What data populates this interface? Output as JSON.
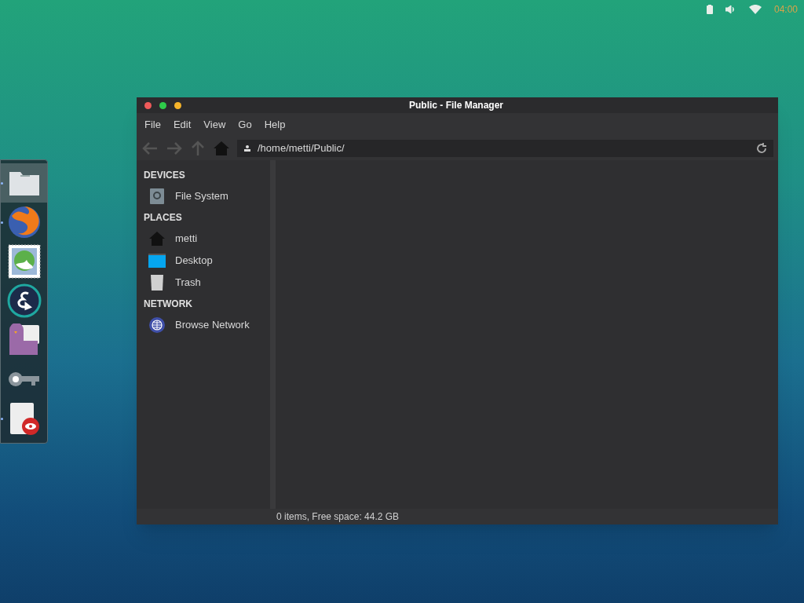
{
  "top_panel": {
    "clock": "04:00"
  },
  "dock": {
    "items": [
      {
        "kind": "folder",
        "running": true,
        "selected": true
      },
      {
        "kind": "browser",
        "running": true,
        "selected": false
      },
      {
        "kind": "mail",
        "running": false,
        "selected": false
      },
      {
        "kind": "editor",
        "running": false,
        "selected": false
      },
      {
        "kind": "chat",
        "running": false,
        "selected": false
      },
      {
        "kind": "key",
        "running": false,
        "selected": false
      },
      {
        "kind": "viewer",
        "running": true,
        "selected": false
      }
    ]
  },
  "window": {
    "title": "Public - File Manager",
    "menu": [
      "File",
      "Edit",
      "View",
      "Go",
      "Help"
    ],
    "toolbar": {
      "path": "/home/metti/Public/"
    },
    "sidebar": {
      "sections": [
        {
          "heading": "DEVICES",
          "items": [
            {
              "kind": "drive",
              "label": "File System"
            }
          ]
        },
        {
          "heading": "PLACES",
          "items": [
            {
              "kind": "home",
              "label": "metti"
            },
            {
              "kind": "desktop",
              "label": "Desktop"
            },
            {
              "kind": "trash",
              "label": "Trash"
            }
          ]
        },
        {
          "heading": "NETWORK",
          "items": [
            {
              "kind": "network",
              "label": "Browse Network"
            }
          ]
        }
      ]
    },
    "status_bar": "0 items, Free space: 44.2 GB"
  }
}
